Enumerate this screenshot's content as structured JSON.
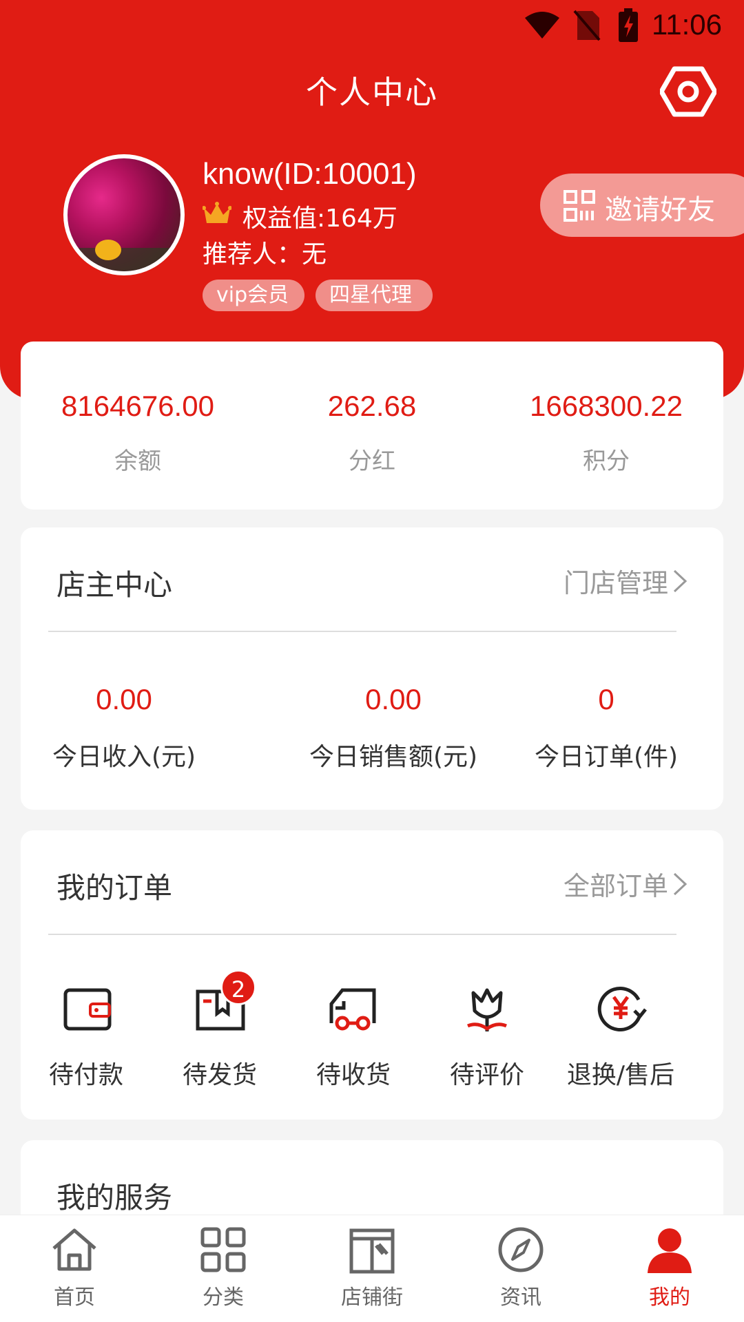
{
  "status_bar": {
    "time": "11:06"
  },
  "header": {
    "title": "个人中心",
    "username": "know(ID:10001)",
    "rights_value": "权益值:164万",
    "referrer": "推荐人：无",
    "tags": [
      "vip会员",
      "四星代理"
    ],
    "invite_label": "邀请好友"
  },
  "stats": [
    {
      "value": "8164676.00",
      "label": "余额"
    },
    {
      "value": "262.68",
      "label": "分红"
    },
    {
      "value": "1668300.22",
      "label": "积分"
    }
  ],
  "shop_center": {
    "title": "店主中心",
    "link": "门店管理",
    "stats": [
      {
        "value": "0.00",
        "label": "今日收入(元)"
      },
      {
        "value": "0.00",
        "label": "今日销售额(元)"
      },
      {
        "value": "0",
        "label": "今日订单(件)"
      }
    ]
  },
  "orders": {
    "title": "我的订单",
    "link": "全部订单",
    "items": [
      {
        "label": "待付款",
        "icon": "wallet-icon"
      },
      {
        "label": "待发货",
        "icon": "package-icon",
        "badge": "2"
      },
      {
        "label": "待收货",
        "icon": "truck-icon"
      },
      {
        "label": "待评价",
        "icon": "flower-icon"
      },
      {
        "label": "退换/售后",
        "icon": "refund-icon"
      }
    ]
  },
  "services": {
    "title": "我的服务"
  },
  "tabbar": {
    "items": [
      {
        "label": "首页",
        "icon": "home-icon"
      },
      {
        "label": "分类",
        "icon": "grid-icon"
      },
      {
        "label": "店铺街",
        "icon": "store-icon"
      },
      {
        "label": "资讯",
        "icon": "compass-icon"
      },
      {
        "label": "我的",
        "icon": "user-icon",
        "active": true
      }
    ]
  },
  "colors": {
    "accent": "#e01c14",
    "tag_bg": "#f08e89"
  }
}
